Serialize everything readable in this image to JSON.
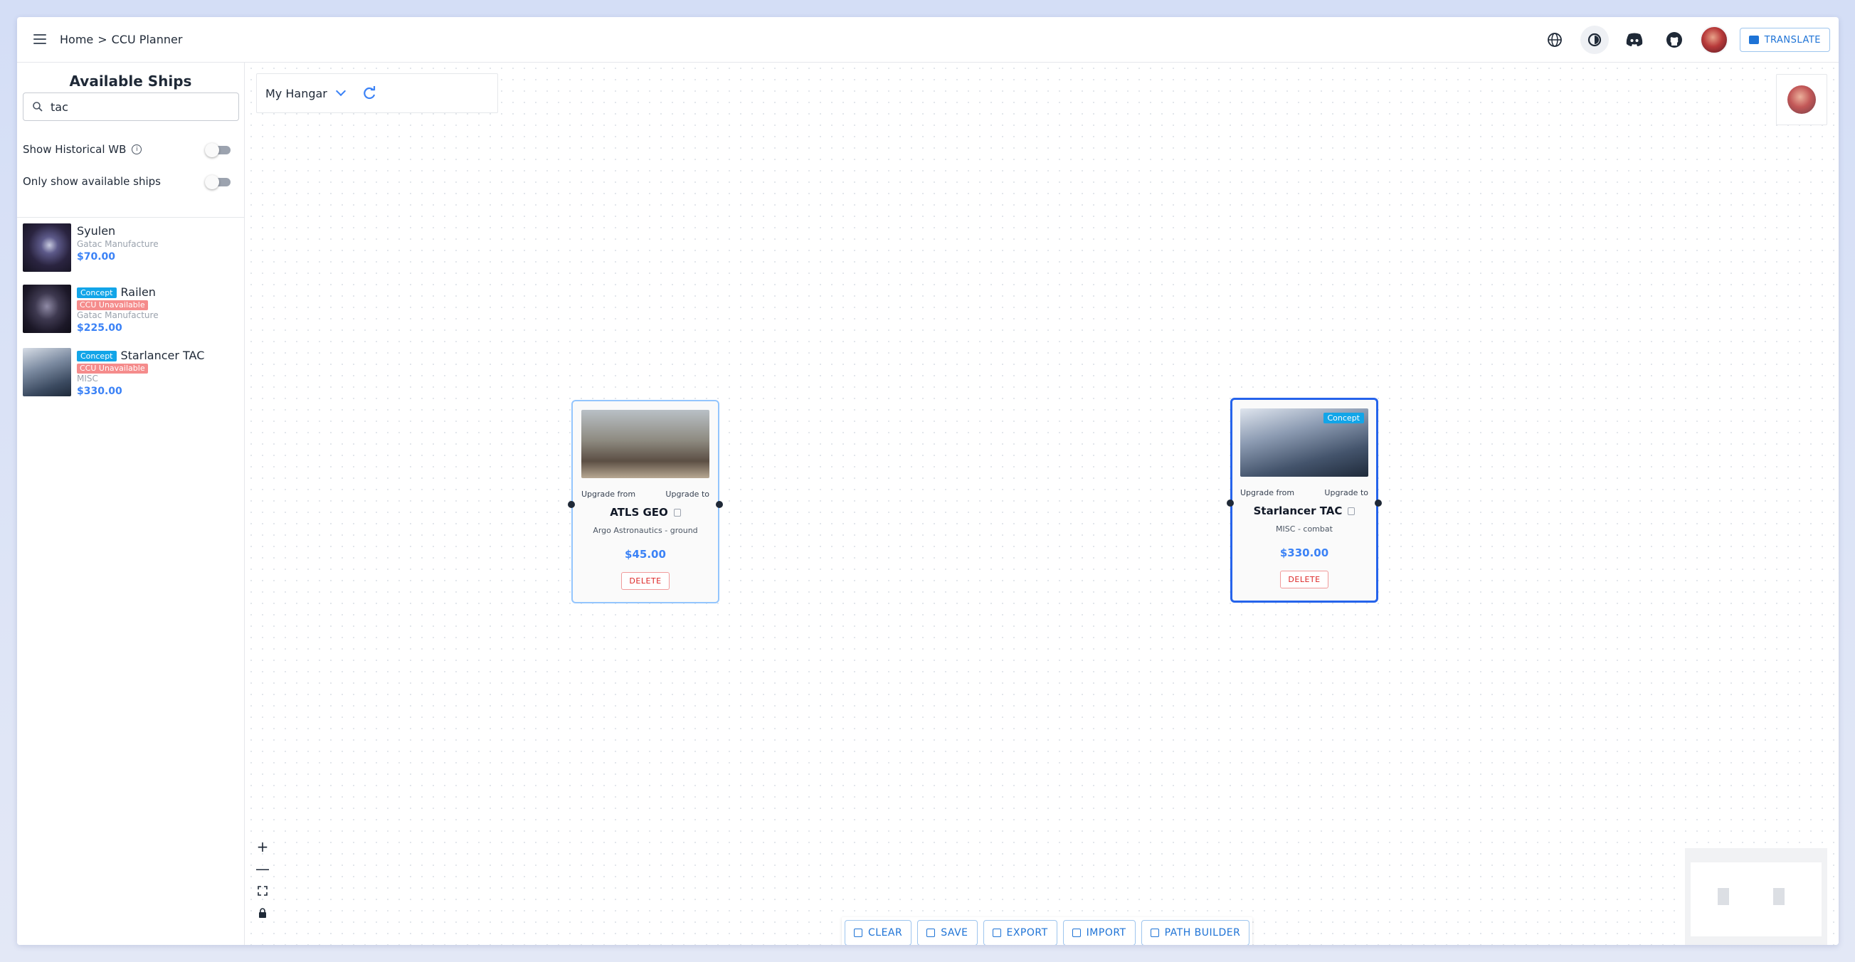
{
  "header": {
    "breadcrumb_home": "Home",
    "breadcrumb_sep": ">",
    "breadcrumb_current": "CCU Planner",
    "translate_label": "TRANSLATE",
    "accent_color": "#1e73d6"
  },
  "sidebar": {
    "title": "Available Ships",
    "search_value": "tac",
    "toggles": [
      {
        "label": "Show Historical WB",
        "on": false
      },
      {
        "label": "Only show available ships",
        "on": false
      }
    ],
    "ships": [
      {
        "name": "Syulen",
        "concept": "",
        "ccu": "",
        "manufacturer": "Gatac Manufacture",
        "price": "$70.00"
      },
      {
        "name": "Railen",
        "concept": "Concept",
        "ccu": "CCU Unavailable",
        "manufacturer": "Gatac Manufacture",
        "price": "$225.00"
      },
      {
        "name": "Starlancer TAC",
        "concept": "Concept",
        "ccu": "CCU Unavailable",
        "manufacturer": "MISC",
        "price": "$330.00"
      }
    ]
  },
  "canvas": {
    "hangar_label": "My Hangar",
    "nodes": [
      {
        "title": "ATLS GEO",
        "subtitle": "Argo Astronautics - ground",
        "price": "$45.00",
        "concept": "",
        "upgrade_from": "Upgrade from",
        "upgrade_to": "Upgrade to",
        "delete_label": "DELETE"
      },
      {
        "title": "Starlancer TAC",
        "subtitle": "MISC - combat",
        "price": "$330.00",
        "concept": "Concept",
        "upgrade_from": "Upgrade from",
        "upgrade_to": "Upgrade to",
        "delete_label": "DELETE"
      }
    ],
    "zoom_controls": {
      "zoom_in": "+",
      "zoom_out": "—"
    }
  },
  "toolbar": {
    "clear_label": "CLEAR",
    "save_label": "SAVE",
    "export_label": "EXPORT",
    "import_label": "IMPORT",
    "path_builder_label": "PATH BUILDER"
  }
}
